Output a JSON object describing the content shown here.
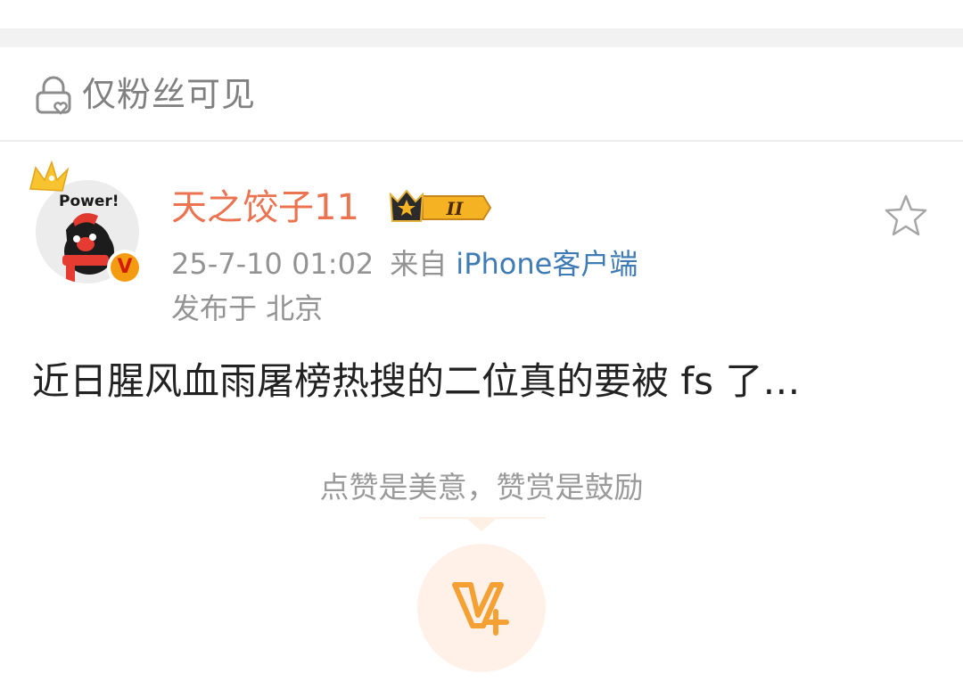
{
  "visibility": {
    "label": "仅粉丝可见",
    "icon": "lock-heart-icon"
  },
  "author": {
    "name": "天之饺子11",
    "avatar_text": "Power!",
    "verified_mark": "V",
    "vip_level": "II",
    "name_color": "#eb7350"
  },
  "post": {
    "timestamp": "25-7-10 01:02",
    "from_label": "来自",
    "source": "iPhone客户端",
    "location": "发布于 北京",
    "text": "近日腥风血雨屠榜热搜的二位真的要被 fs 了…",
    "source_color": "#3f7bb5"
  },
  "reward": {
    "hint": "点赞是美意，赞赏是鼓励",
    "icon": "reward-v-plus-icon",
    "accent": "#f5a032"
  }
}
